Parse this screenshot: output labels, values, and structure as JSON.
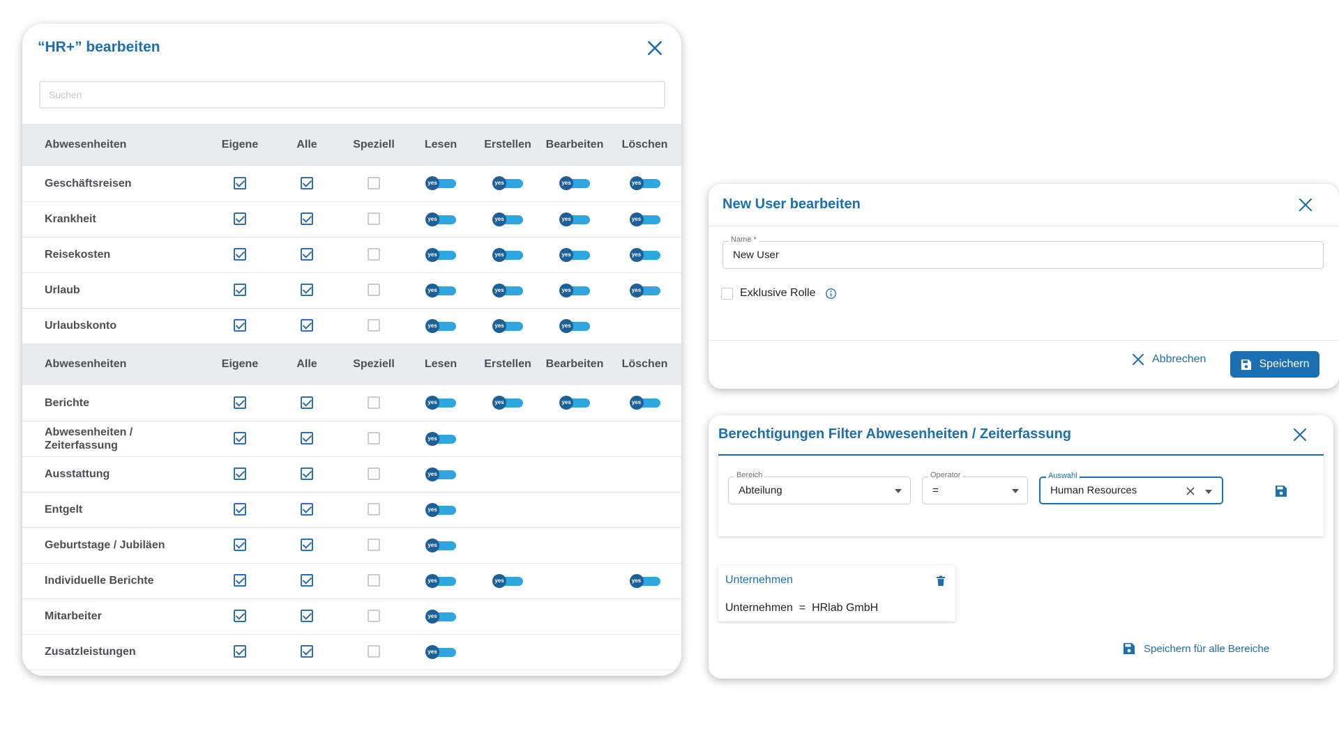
{
  "role_dialog": {
    "title": "“HR+” bearbeiten",
    "search_placeholder": "Suchen",
    "sections": [
      {
        "headers": [
          "Abwesenheiten",
          "Eigene",
          "Alle",
          "Speziell",
          "Lesen",
          "Erstellen",
          "Bearbeiten",
          "Löschen"
        ],
        "rows": [
          {
            "label": "Geschäftsreisen",
            "eigene": true,
            "alle": true,
            "speziell": false,
            "toggles": [
              true,
              true,
              true,
              true
            ]
          },
          {
            "label": "Krankheit",
            "eigene": true,
            "alle": true,
            "speziell": false,
            "toggles": [
              true,
              true,
              true,
              true
            ]
          },
          {
            "label": "Reisekosten",
            "eigene": true,
            "alle": true,
            "speziell": false,
            "toggles": [
              true,
              true,
              true,
              true
            ]
          },
          {
            "label": "Urlaub",
            "eigene": true,
            "alle": true,
            "speziell": false,
            "toggles": [
              true,
              true,
              true,
              true
            ]
          },
          {
            "label": "Urlaubskonto",
            "eigene": true,
            "alle": true,
            "speziell": false,
            "toggles": [
              true,
              true,
              true,
              false
            ]
          }
        ]
      },
      {
        "headers": [
          "Abwesenheiten",
          "Eigene",
          "Alle",
          "Speziell",
          "Lesen",
          "Erstellen",
          "Bearbeiten",
          "Löschen"
        ],
        "rows": [
          {
            "label": "Berichte",
            "eigene": true,
            "alle": true,
            "speziell": false,
            "toggles": [
              true,
              true,
              true,
              true
            ]
          },
          {
            "label": "Abwesenheiten / Zeiterfassung",
            "eigene": true,
            "alle": true,
            "speziell": false,
            "toggles": [
              true,
              false,
              false,
              false
            ]
          },
          {
            "label": "Ausstattung",
            "eigene": true,
            "alle": true,
            "speziell": false,
            "toggles": [
              true,
              false,
              false,
              false
            ]
          },
          {
            "label": "Entgelt",
            "eigene": true,
            "alle": true,
            "speziell": false,
            "toggles": [
              true,
              false,
              false,
              false
            ]
          },
          {
            "label": "Geburtstage / Jubiläen",
            "eigene": true,
            "alle": true,
            "speziell": false,
            "toggles": [
              true,
              false,
              false,
              false
            ]
          },
          {
            "label": "Individuelle Berichte",
            "eigene": true,
            "alle": true,
            "speziell": false,
            "toggles": [
              true,
              true,
              false,
              true
            ]
          },
          {
            "label": "Mitarbeiter",
            "eigene": true,
            "alle": true,
            "speziell": false,
            "toggles": [
              true,
              false,
              false,
              false
            ]
          },
          {
            "label": "Zusatzleistungen",
            "eigene": true,
            "alle": true,
            "speziell": false,
            "toggles": [
              true,
              false,
              false,
              false
            ]
          }
        ]
      }
    ],
    "toggle_text": "yes"
  },
  "user_dialog": {
    "title": "New User bearbeiten",
    "name_label": "Name *",
    "name_value": "New User",
    "exclusive_label": "Exklusive Rolle",
    "cancel_label": "Abbrechen",
    "save_label": "Speichern"
  },
  "filter_dialog": {
    "title": "Berechtigungen Filter Abwesenheiten / Zeiterfassung",
    "bereich_label": "Bereich",
    "bereich_value": "Abteilung",
    "operator_label": "Operator",
    "operator_value": "=",
    "auswahl_label": "Auswahl",
    "auswahl_value": "Human Resources",
    "card_title": "Unternehmen",
    "card_condition": "Unternehmen  =  HRlab GmbH",
    "save_all_label": "Speichern für alle Bereiche"
  },
  "colors": {
    "primary": "#1c6fb0",
    "toggle_track": "#2fa6df",
    "toggle_knob": "#1d5f99",
    "header_bg": "#e9ebee"
  }
}
